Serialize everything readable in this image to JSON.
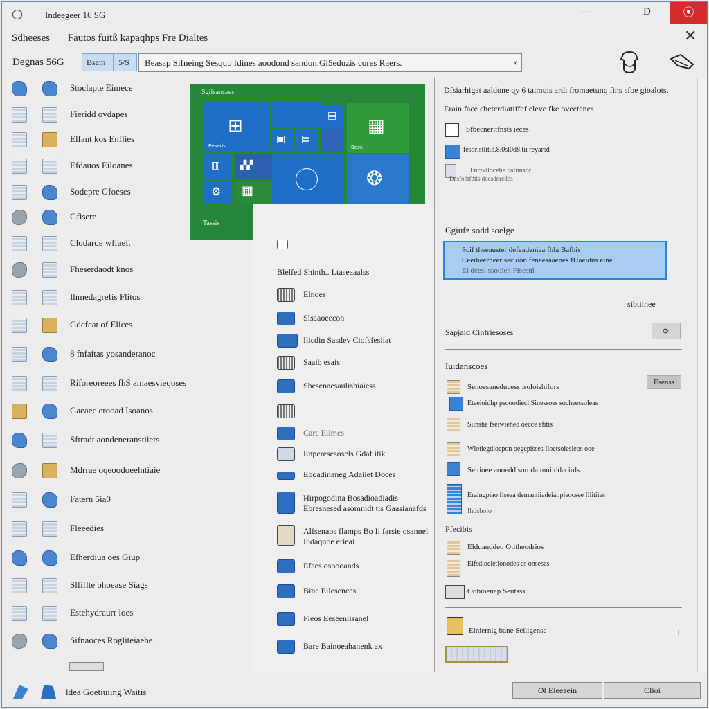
{
  "titlebar": {
    "title": "Indeegeer 16 SG",
    "min_label": "—",
    "max_label": "D",
    "close_label": "⦿"
  },
  "menu": {
    "left": "Sdheeses",
    "right": "Fautos fuitß kapaqhps Fre Dialtes",
    "close_label": "✕"
  },
  "toolbar": {
    "label": "Degnas",
    "label_num": "56G",
    "seg1": "Bsam",
    "seg2": "5/S",
    "address": "Beasap Sifneing Sesqub fdines aoodond sandon.Gl5eduzis cores Raers.",
    "address_chevron": "‹"
  },
  "left_items": [
    {
      "label": "Stoclapte Eimece"
    },
    {
      "label": "Fieridd ovdapes"
    },
    {
      "label": "Elfant kos Enflies"
    },
    {
      "label": "Efdauos Eiloanes"
    },
    {
      "label": "Sodepre Gfoeses"
    },
    {
      "label": "Gfisere"
    },
    {
      "label": "Clodarde wffaef."
    },
    {
      "label": "Fheserdaodt knos"
    },
    {
      "label": "Ihmedagrefis Flitos"
    },
    {
      "label": "Gdcfcat of Elices"
    },
    {
      "label": "8 fnfaitas yosanderanoc"
    },
    {
      "label": "Riforeoreees fhS amaesvieqoses"
    },
    {
      "label": "Gaeaec erooad Isoanos"
    },
    {
      "label": "Sftradt aondeneranstiiers"
    },
    {
      "label": "Mdrrae oqeoodoeelntiaie"
    },
    {
      "label": "Fatern 5ia0"
    },
    {
      "label": "Fleeedies"
    },
    {
      "label": "Efherdiua oes Giup"
    },
    {
      "label": "Slfiflte ohoease Siags"
    },
    {
      "label": "Estehydraurr loes"
    },
    {
      "label": "Sifnaoces Rogliteiaehe"
    }
  ],
  "tiles": {
    "header": "Sgifsancees",
    "footer": "Tassis",
    "sub1": "Eeseds",
    "sub2": "Bese"
  },
  "mid_items": [
    {
      "label": ""
    },
    {
      "label": "Blelfed Shinth.. Ltaseaaalss"
    },
    {
      "label": "Elnoes"
    },
    {
      "label": "Slsaaoeecon"
    },
    {
      "label": "Ilicdin Sasdev Ciofsfesiiat"
    },
    {
      "label": "Saaib esais"
    },
    {
      "label": "Shesenaesaulishiaiess"
    },
    {
      "label": ""
    },
    {
      "label": "Care Eilmes"
    },
    {
      "label": "Enperesesosels Gdaf itik"
    },
    {
      "label": "Eboadinaneg Adaiiet Doces"
    },
    {
      "label": "Hirpogodina Bosadioadiadis"
    },
    {
      "label": "Alfsenaos flamps Bo Ii farsie osannel"
    },
    {
      "label": "Efaes osoooands"
    },
    {
      "label": "Bine Eilesences"
    },
    {
      "label": "Fleos Eeseeniisanel"
    },
    {
      "label": "Bare Bainoeahanenk ax"
    }
  ],
  "mid_extra": {
    "l10b": "Ebresnesed asomnidt tis Gaasianafds",
    "l12b": "Ihdaqnoe erieai"
  },
  "right": {
    "desc": "Dfsiarhigat aaldone qy 6 taimuis ardi fromaetunq fins sfoe gioalots.",
    "link_header": "Erain face chetcrdiatiffef eleve fke oveetenes",
    "row1": "Sfbecneritfnsts ieces",
    "row2": "fesorlstlit.d.8.0sl0d8.tii reyarsd",
    "row3": "Fncodlocehe caliinsor",
    "row3b": "Desfodtfdtls doesdnrcdds",
    "section1": "Cgiufz sodd soelge",
    "sel1": "Scif theeauster defeadeniaa fhla Bafhis",
    "sel2": "Ceeibeerneer sec oon feneesaaenes fHaeidns eine",
    "sel3": "Ei deesi ssoolen Fisesnl",
    "side_label": "sibtiinee",
    "section2": "Sapjaid Cinfriesoses",
    "btn1": "⟳",
    "section3": "Iuidanscoes",
    "btn2": "Esenss",
    "item1": "Senoesaneducess .soloishifors",
    "item2": "Eteeioidhp psooodiecl Sinessoes socheessoleas",
    "item3": "Siinshe fseiwiehed oecce efitis",
    "item4": "Wlotiegdioepon oegepisses Iloetsoiesleos ooe",
    "item5": "Seitioee aooedd soroda muiiddacirds",
    "item6": "Eraingpiao fiseaa demantiiadeiai.pleocsee filitiies",
    "item6b": "Ihdsboio",
    "section4": "Pfecibis",
    "item7": "Elduanddeo Otitheodrios",
    "item8": "Elfsdioeletionodes cs onseses",
    "item9": "Oobioenap Seutsss",
    "item10": "Elniernig bane Selligense",
    "scroll_glyph": "ǀ"
  },
  "status": {
    "text": "ldea Goetiuiing Waitis"
  },
  "footer": {
    "btn1": "Ol Eieeaein",
    "btn2": "Clioi"
  }
}
